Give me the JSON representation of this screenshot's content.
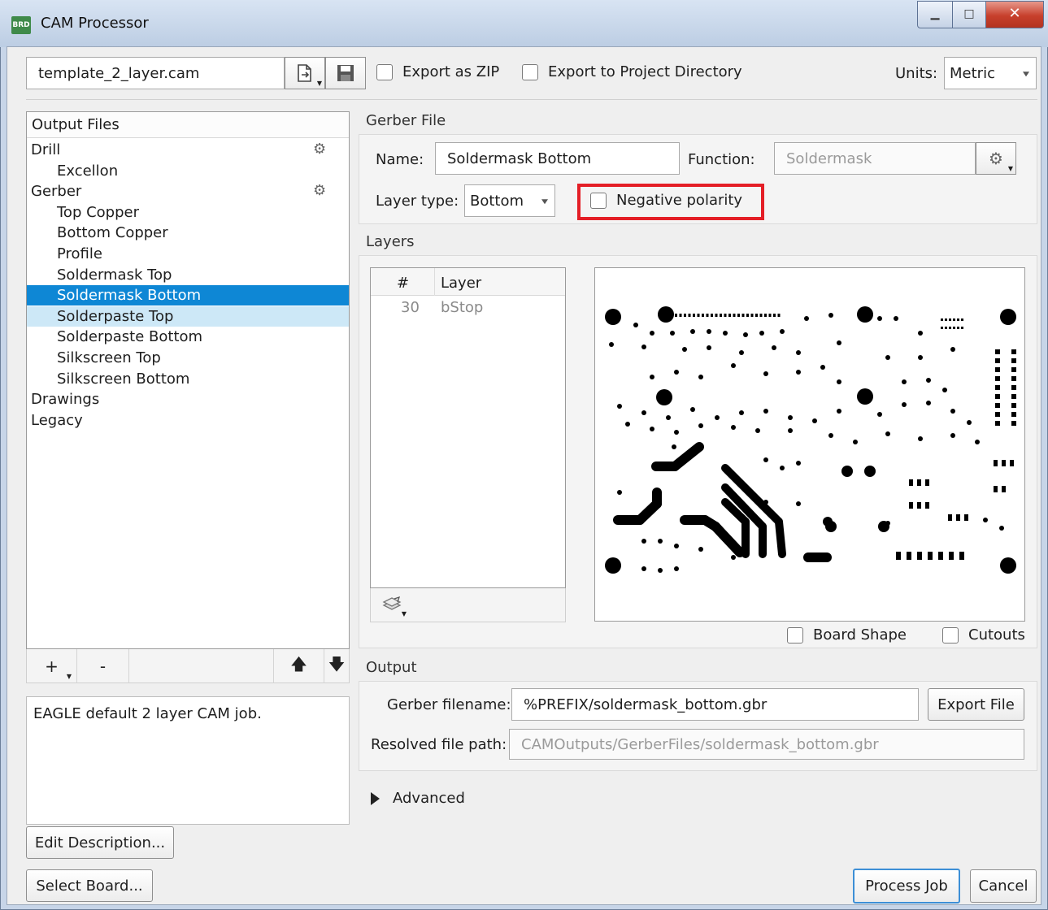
{
  "window": {
    "title": "CAM Processor",
    "app_badge": "BRD"
  },
  "toolbar": {
    "job_file": "template_2_layer.cam",
    "export_zip_label": "Export as ZIP",
    "export_project_dir_label": "Export to Project Directory",
    "units_label": "Units:",
    "units_value": "Metric"
  },
  "output_files": {
    "header": "Output Files",
    "items": [
      {
        "label": "Drill",
        "level": 0,
        "gear": true
      },
      {
        "label": "Excellon",
        "level": 1
      },
      {
        "label": "Gerber",
        "level": 0,
        "gear": true
      },
      {
        "label": "Top Copper",
        "level": 1
      },
      {
        "label": "Bottom Copper",
        "level": 1
      },
      {
        "label": "Profile",
        "level": 1
      },
      {
        "label": "Soldermask Top",
        "level": 1
      },
      {
        "label": "Soldermask Bottom",
        "level": 1,
        "selected": true
      },
      {
        "label": "Solderpaste Top",
        "level": 1,
        "hover": true
      },
      {
        "label": "Solderpaste Bottom",
        "level": 1
      },
      {
        "label": "Silkscreen Top",
        "level": 1
      },
      {
        "label": "Silkscreen Bottom",
        "level": 1
      },
      {
        "label": "Drawings",
        "level": 0
      },
      {
        "label": "Legacy",
        "level": 0
      }
    ],
    "add_label": "+",
    "remove_label": "-"
  },
  "description": "EAGLE default 2 layer CAM job.",
  "edit_description_label": "Edit Description...",
  "select_board_label": "Select Board...",
  "gerber_file": {
    "section": "Gerber File",
    "name_label": "Name:",
    "name_value": "Soldermask Bottom",
    "function_label": "Function:",
    "function_value": "Soldermask",
    "layer_type_label": "Layer type:",
    "layer_type_value": "Bottom",
    "negative_polarity_label": "Negative polarity"
  },
  "layers": {
    "section": "Layers",
    "col_num": "#",
    "col_layer": "Layer",
    "rows": [
      {
        "num": "30",
        "name": "bStop"
      }
    ],
    "board_shape_label": "Board Shape",
    "cutouts_label": "Cutouts"
  },
  "output": {
    "section": "Output",
    "gerber_filename_label": "Gerber filename:",
    "gerber_filename_value": "%PREFIX/soldermask_bottom.gbr",
    "export_file_label": "Export File",
    "resolved_label": "Resolved file path:",
    "resolved_value": "CAMOutputs/GerberFiles/soldermask_bottom.gbr"
  },
  "advanced_label": "Advanced",
  "process_job_label": "Process Job",
  "cancel_label": "Cancel",
  "colors": {
    "selection": "#0e87d5",
    "hover": "#cde8f7",
    "highlight_box": "#e41e26",
    "close_button": "#c7402c"
  }
}
